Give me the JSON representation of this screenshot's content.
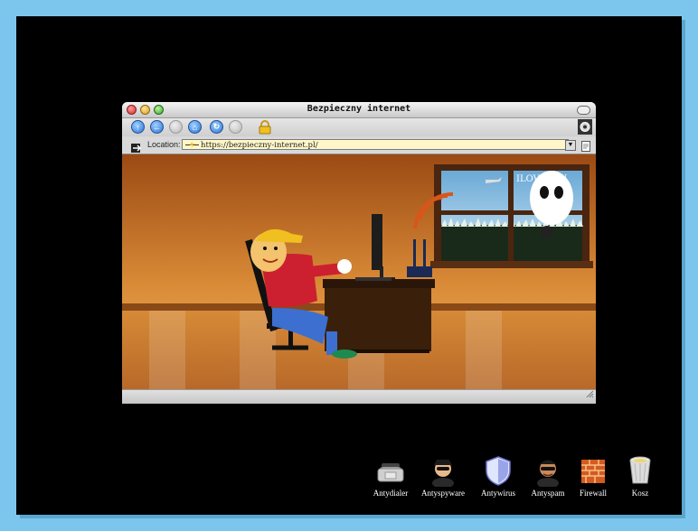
{
  "window": {
    "title": "Bezpieczny internet",
    "location_label": "Location:",
    "url": "https://bezpieczny-internet.pl/"
  },
  "scene": {
    "window_caption": "ILOVEYOU"
  },
  "dock": {
    "items": [
      {
        "label": "Antydialer",
        "icon": "phone-modem-icon"
      },
      {
        "label": "Antyspyware",
        "icon": "spy-icon"
      },
      {
        "label": "Antywirus",
        "icon": "shield-icon"
      },
      {
        "label": "Antyspam",
        "icon": "agent-icon"
      },
      {
        "label": "Firewall",
        "icon": "brick-wall-icon"
      },
      {
        "label": "Kosz",
        "icon": "trash-icon"
      }
    ]
  },
  "colors": {
    "desktop_border": "#7cc6ee",
    "screen": "#000000",
    "wall": "#c77a2a",
    "floor": "#d98d34",
    "url_bg": "#fff7c8"
  }
}
